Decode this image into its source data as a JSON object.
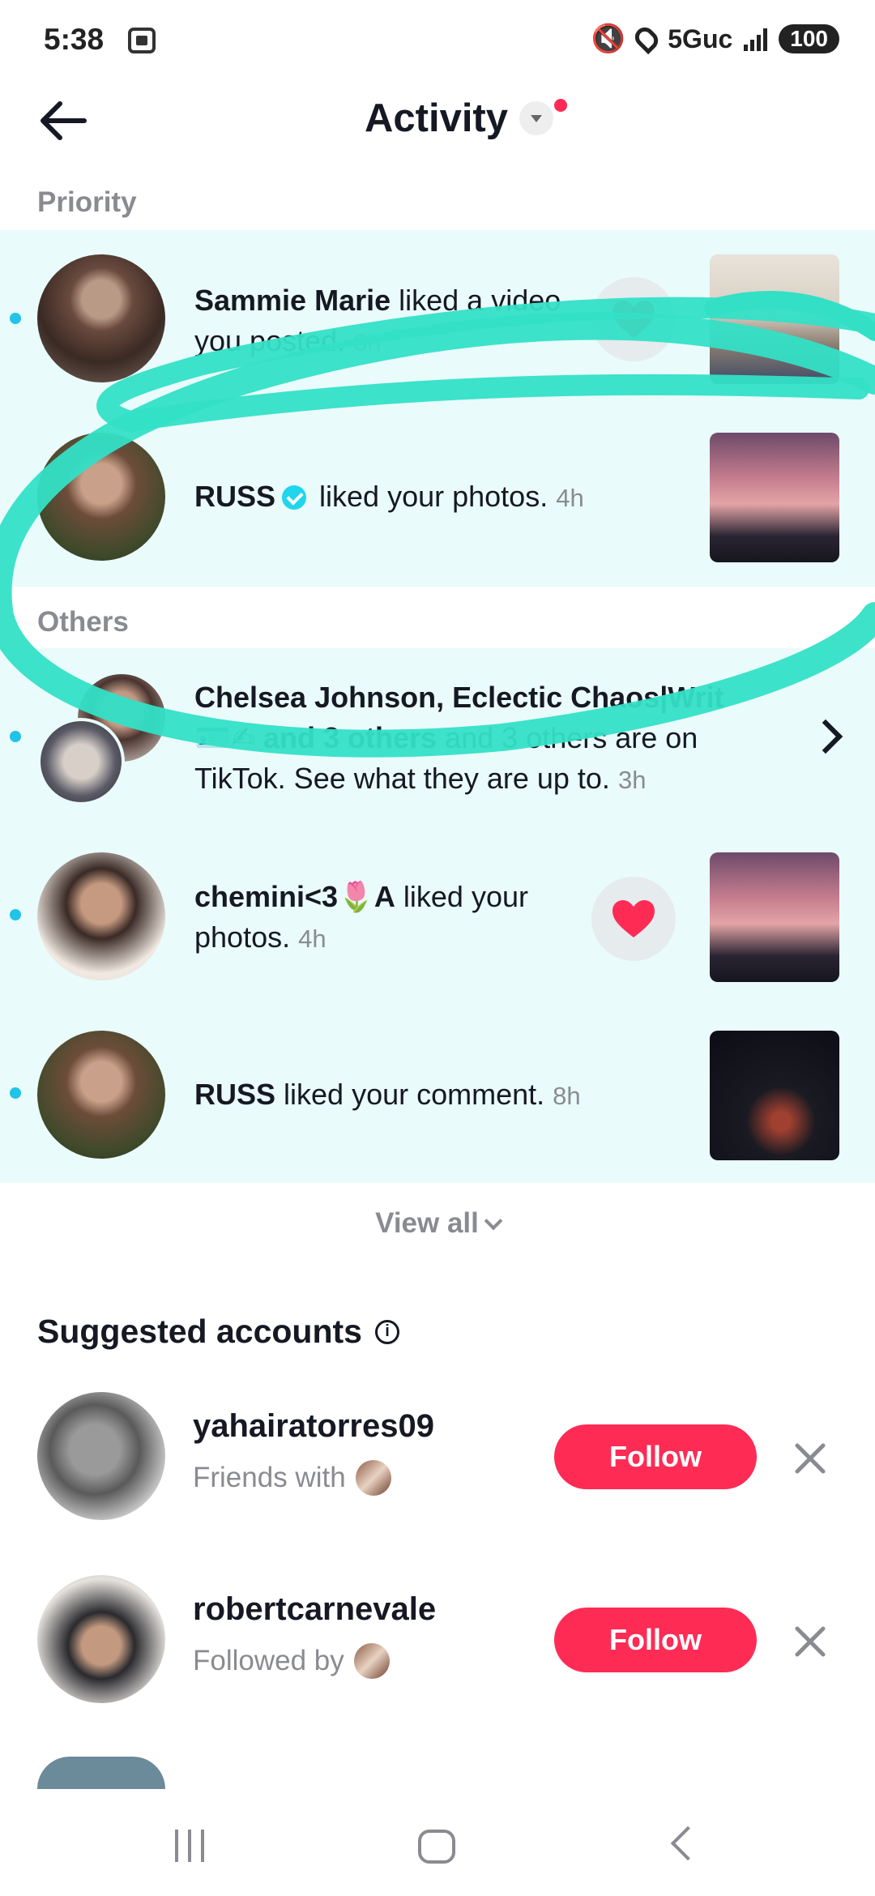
{
  "status_bar": {
    "time": "5:38",
    "network": "5Guc",
    "battery": "100"
  },
  "header": {
    "title": "Activity"
  },
  "sections": {
    "priority_label": "Priority",
    "others_label": "Others"
  },
  "notifications": [
    {
      "user": "Sammie Marie",
      "action": " liked a video you posted.",
      "time": "6h",
      "unread": true
    },
    {
      "user": "RUSS",
      "verified": true,
      "action": " liked your photos.",
      "time": "4h",
      "unread": false
    },
    {
      "user": "Chelsea Johnson, Eclectic Chaos|Writ",
      "action": " and 3 others are on TikTok. See what they are up to.",
      "prefix_emoji": "🪪✍",
      "time": "3h",
      "unread": true
    },
    {
      "user": "chemini<3🌷A",
      "action": " liked your photos.",
      "time": "4h",
      "unread": true
    },
    {
      "user": "RUSS",
      "action": " liked your comment.",
      "time": "8h",
      "unread": true
    }
  ],
  "view_all": "View all",
  "suggested": {
    "title": "Suggested accounts",
    "accounts": [
      {
        "name": "yahairatorres09",
        "subtitle": "Friends with",
        "button": "Follow"
      },
      {
        "name": "robertcarnevale",
        "subtitle": "Followed by",
        "button": "Follow"
      }
    ]
  },
  "colors": {
    "accent": "#fe2c55",
    "highlight_bg": "#e9fbfb",
    "scribble": "#33e0c6"
  }
}
